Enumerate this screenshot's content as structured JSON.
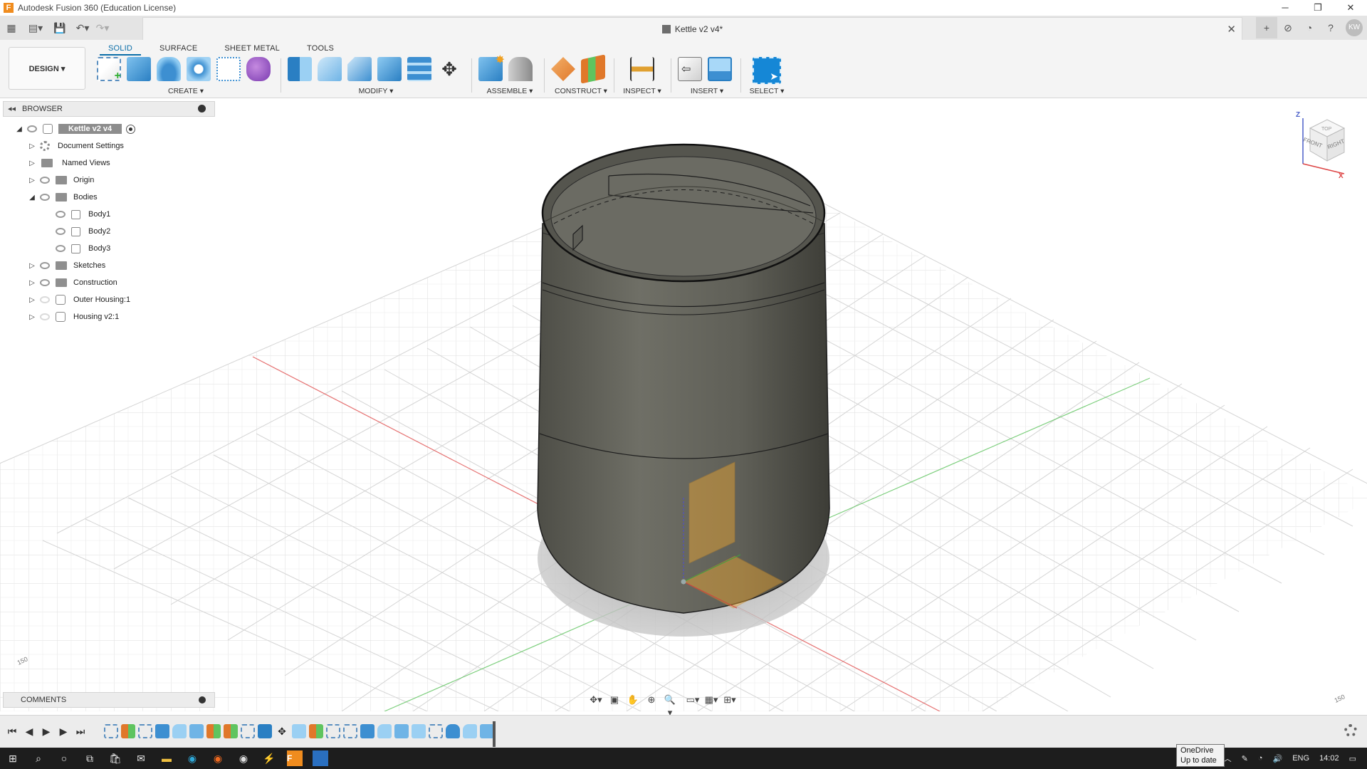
{
  "window": {
    "title": "Autodesk Fusion 360 (Education License)",
    "logo": "F"
  },
  "document": {
    "tab_title": "Kettle v2 v4*"
  },
  "user": {
    "initials": "KW"
  },
  "toolbar": {
    "workspace_label": "DESIGN",
    "tabs": [
      "SOLID",
      "SURFACE",
      "SHEET METAL",
      "TOOLS"
    ],
    "groups": {
      "create": "CREATE",
      "modify": "MODIFY",
      "assemble": "ASSEMBLE",
      "construct": "CONSTRUCT",
      "inspect": "INSPECT",
      "insert": "INSERT",
      "select": "SELECT"
    }
  },
  "browser": {
    "title": "BROWSER",
    "root": "Kettle v2 v4",
    "items": [
      "Document Settings",
      "Named Views",
      "Origin",
      "Bodies",
      "Body1",
      "Body2",
      "Body3",
      "Sketches",
      "Construction",
      "Outer Housing:1",
      "Housing v2:1"
    ]
  },
  "viewcube": {
    "z": "Z",
    "x": "X",
    "front": "FRONT",
    "right": "RIGHT",
    "top": "TOP"
  },
  "canvas": {
    "grid_label_left": "150",
    "grid_label_right": "150"
  },
  "comments": {
    "title": "COMMENTS"
  },
  "taskbar": {
    "language": "ENG",
    "time": "14:02",
    "tooltip_line1": "OneDrive",
    "tooltip_line2": "Up to date"
  },
  "colors": {
    "accent": "#0a6ea8",
    "select_blue": "#1587d6",
    "body": "#6a6a60",
    "x_axis": "#e05050",
    "y_axis": "#5fc45f"
  }
}
